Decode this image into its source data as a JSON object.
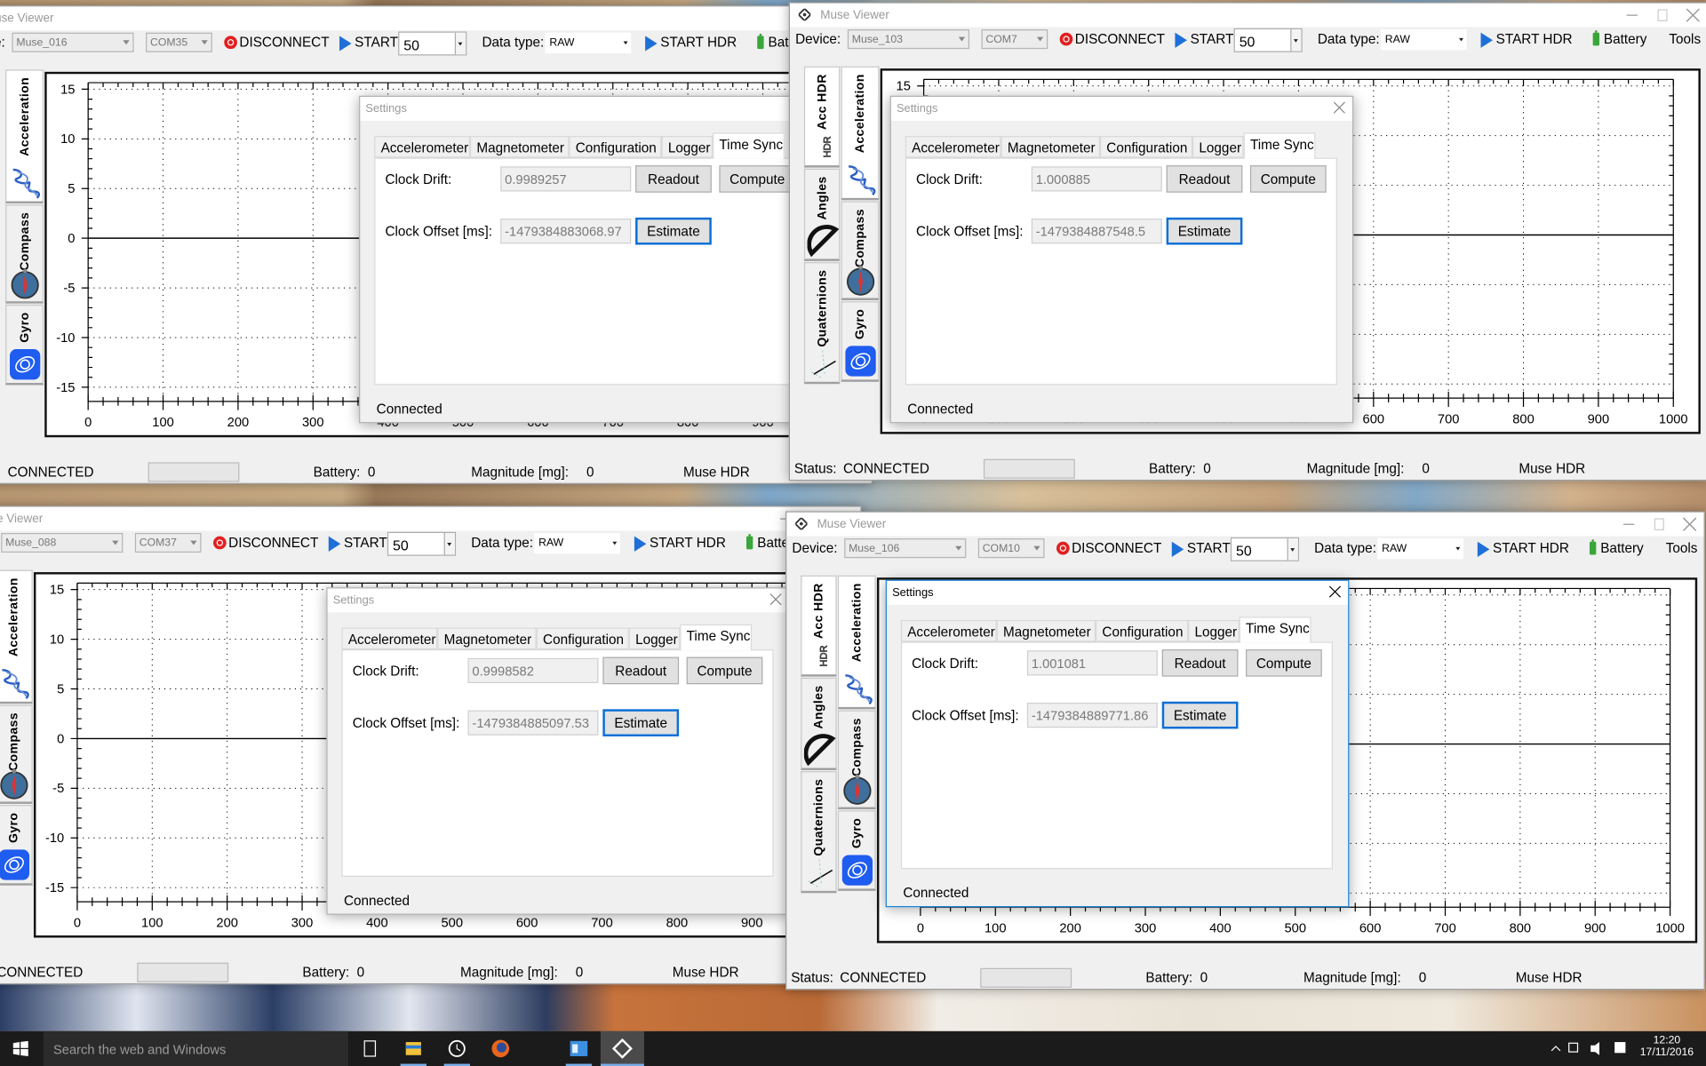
{
  "toolbar": {
    "device_label": "Device:",
    "disconnect": "DISCONNECT",
    "start": "START",
    "data_type_label": "Data type:",
    "start_hdr": "START HDR",
    "battery": "Battery",
    "tools": "Tools"
  },
  "side_tabs": {
    "col1": [
      "Acc HDR",
      "Angles",
      "Quaternions"
    ],
    "col2": [
      "Acceleration",
      "Compass",
      "Gyro"
    ]
  },
  "plot": {
    "y_ticks": [
      15,
      10,
      5,
      0,
      -5,
      -10,
      -15
    ],
    "x_ticks": [
      0,
      100,
      200,
      300,
      400,
      500,
      600,
      700,
      800,
      900,
      1000
    ]
  },
  "statusbar": {
    "status_label": "Status:",
    "battery_label": "Battery:",
    "magnitude_label": "Magnitude [mg]:",
    "mode": "Muse HDR"
  },
  "windows": [
    {
      "title": "Muse Viewer",
      "device": "Muse_016",
      "port": "COM35",
      "rate": "50",
      "data_type": "RAW",
      "status": "CONNECTED",
      "battery_value": "0",
      "magnitude_value": "0"
    },
    {
      "title": "Muse Viewer",
      "device": "Muse_103",
      "port": "COM7",
      "rate": "50",
      "data_type": "RAW",
      "status": "CONNECTED",
      "battery_value": "0",
      "magnitude_value": "0"
    },
    {
      "title": "Muse Viewer",
      "device": "Muse_088",
      "port": "COM37",
      "rate": "50",
      "data_type": "RAW",
      "status": "CONNECTED",
      "battery_value": "0",
      "magnitude_value": "0"
    },
    {
      "title": "Muse Viewer",
      "device": "Muse_106",
      "port": "COM10",
      "rate": "50",
      "data_type": "RAW",
      "status": "CONNECTED",
      "battery_value": "0",
      "magnitude_value": "0"
    }
  ],
  "settings": {
    "title": "Settings",
    "tabs": [
      "Accelerometer",
      "Magnetometer",
      "Configuration",
      "Logger",
      "Time Sync"
    ],
    "selected_tab": "Time Sync",
    "clock_drift_label": "Clock Drift:",
    "clock_offset_label": "Clock Offset [ms]:",
    "readout": "Readout",
    "compute": "Compute",
    "estimate": "Estimate",
    "status": "Connected"
  },
  "dialogs": [
    {
      "clock_drift": "0.9989257",
      "clock_offset": "-1479384883068.97"
    },
    {
      "clock_drift": "1.000885",
      "clock_offset": "-1479384887548.5"
    },
    {
      "clock_drift": "0.9998582",
      "clock_offset": "-1479384885097.53"
    },
    {
      "clock_drift": "1.001081",
      "clock_offset": "-1479384889771.86"
    }
  ],
  "taskbar": {
    "search_placeholder": "Search the web and Windows",
    "time": "12:20",
    "date": "17/11/2016"
  }
}
